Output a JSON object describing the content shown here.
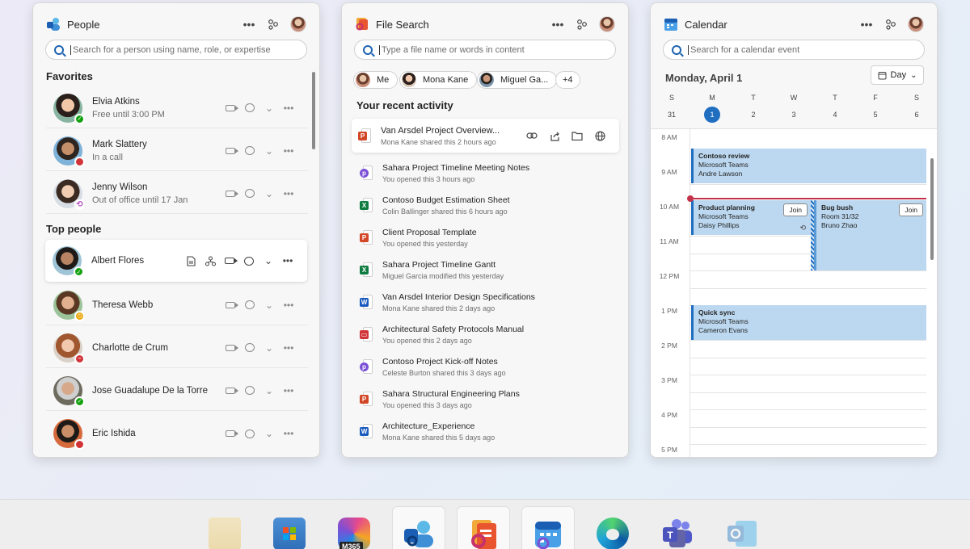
{
  "people": {
    "title": "People",
    "search_placeholder": "Search for a person using name, role, or expertise",
    "favorites_title": "Favorites",
    "top_title": "Top people",
    "favorites": [
      {
        "name": "Elvia Atkins",
        "status": "Free until 3:00 PM",
        "presence": "available"
      },
      {
        "name": "Mark Slattery",
        "status": "In a call",
        "presence": "busy"
      },
      {
        "name": "Jenny Wilson",
        "status": "Out of office until 17 Jan",
        "presence": "out-of-office"
      }
    ],
    "top": [
      {
        "name": "Albert Flores",
        "presence": "available"
      },
      {
        "name": "Theresa Webb",
        "presence": "away"
      },
      {
        "name": "Charlotte de Crum",
        "presence": "do-not-disturb"
      },
      {
        "name": "Jose Guadalupe De la Torre",
        "presence": "available"
      },
      {
        "name": "Eric Ishida",
        "presence": "busy"
      }
    ]
  },
  "files": {
    "title": "File Search",
    "search_placeholder": "Type a file name or words in content",
    "chips": [
      "Me",
      "Mona Kane",
      "Miguel Ga...",
      "+4"
    ],
    "recent_title": "Your recent activity",
    "items": [
      {
        "name": "Van Arsdel Project Overview...",
        "meta": "Mona Kane shared this 2 hours ago",
        "type": "ppt"
      },
      {
        "name": "Sahara Project Timeline Meeting Notes",
        "meta": "You opened this 3 hours ago",
        "type": "loop"
      },
      {
        "name": "Contoso Budget Estimation Sheet",
        "meta": "Colin Ballinger shared this 6 hours ago",
        "type": "xls"
      },
      {
        "name": "Client Proposal Template",
        "meta": "You opened this yesterday",
        "type": "ppt"
      },
      {
        "name": "Sahara Project Timeline Gantt",
        "meta": "Miguel Garcia modified this yesterday",
        "type": "xls"
      },
      {
        "name": "Van Arsdel Interior Design Specifications",
        "meta": "Mona Kane shared this 2 days ago",
        "type": "word"
      },
      {
        "name": "Architectural Safety Protocols Manual",
        "meta": "You opened this 2 days ago",
        "type": "pdf"
      },
      {
        "name": "Contoso Project Kick-off  Notes",
        "meta": "Celeste Burton shared this 3 days ago",
        "type": "loop"
      },
      {
        "name": "Sahara Structural Engineering Plans",
        "meta": "You opened this 3 days ago",
        "type": "ppt"
      },
      {
        "name": "Architecture_Experience",
        "meta": "Mona Kane shared this 5 days ago",
        "type": "word"
      }
    ]
  },
  "calendar": {
    "title": "Calendar",
    "search_placeholder": "Search for a calendar event",
    "date": "Monday, April 1",
    "view": "Day",
    "weekdays": [
      "S",
      "M",
      "T",
      "W",
      "T",
      "F",
      "S"
    ],
    "daynums": [
      "31",
      "1",
      "2",
      "3",
      "4",
      "5",
      "6"
    ],
    "hours": [
      "8 AM",
      "9 AM",
      "10 AM",
      "11 AM",
      "12 PM",
      "1 PM",
      "2 PM",
      "3 PM",
      "4 PM",
      "5 PM"
    ],
    "events": [
      {
        "title": "Contoso review",
        "line1": "Microsoft Teams",
        "line2": "Andre Lawson"
      },
      {
        "title": "Product planning",
        "line1": "Microsoft Teams",
        "line2": "Daisy Phillips",
        "join": "Join"
      },
      {
        "title": "Bug bush",
        "line1": "Room 31/32",
        "line2": "Bruno Zhao",
        "join": "Join"
      },
      {
        "title": "Quick sync",
        "line1": "Microsoft Teams",
        "line2": "Cameron Evans"
      }
    ]
  },
  "taskbar": {
    "m365_label": "M365"
  },
  "colors": {
    "accent": "#1f6ec0",
    "event_fill": "#bcd8f0",
    "now_line": "#c4314b"
  }
}
